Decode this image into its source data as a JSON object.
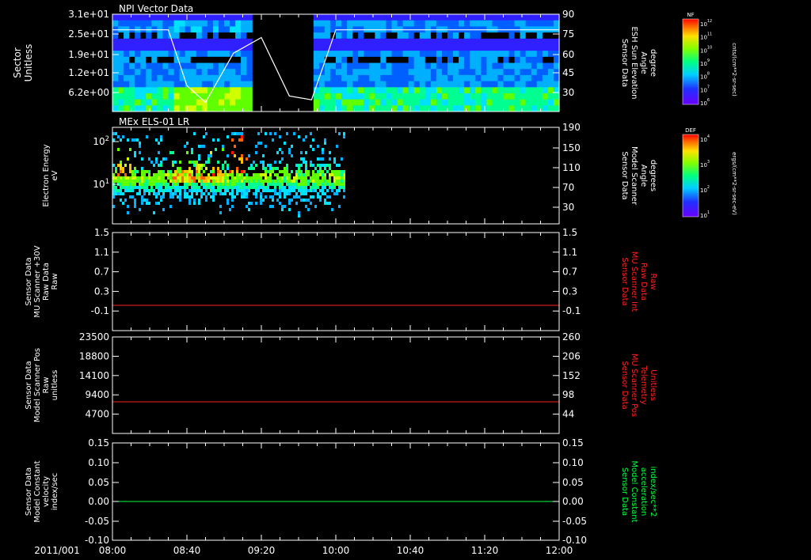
{
  "colors": {
    "background": "#000000",
    "axis": "#ffffff",
    "red_trace": "#ff2020",
    "green_trace": "#00ff40",
    "elevation_curve": "#ffffff"
  },
  "time_axis": {
    "date_label": "2011/001",
    "ticks": [
      "08:00",
      "08:40",
      "09:20",
      "10:00",
      "10:40",
      "11:20",
      "12:00"
    ],
    "range_minutes": [
      0,
      240
    ]
  },
  "panels": [
    {
      "key": "npi",
      "title": "NPI Vector Data",
      "left_label": [
        "Sector",
        "Unitless"
      ],
      "left_ticks": [
        "3.1e+01",
        "2.5e+01",
        "1.9e+01",
        "1.2e+01",
        "6.2e+00"
      ],
      "right_label": [
        "Sensor Data",
        "ESH Sun Elevation",
        "Angle",
        "degree"
      ],
      "right_ticks": [
        "90",
        "75",
        "60",
        "45",
        "30"
      ],
      "colorbar": {
        "label": "NF",
        "units": "cnts/(cm**2-sr-sec)",
        "ticks": [
          "10^12",
          "10^11",
          "10^10",
          "10^9",
          "10^8",
          "10^7",
          "10^6"
        ]
      }
    },
    {
      "key": "els",
      "title": "MEx ELS-01 LR",
      "left_label": [
        "Electron Energy",
        "eV"
      ],
      "left_ticks": [
        "10^2",
        "10^1"
      ],
      "right_label": [
        "Sensor Data",
        "Model Scanner",
        "Angle",
        "degrees"
      ],
      "right_ticks": [
        "190",
        "150",
        "110",
        "70",
        "30"
      ],
      "colorbar": {
        "label": "DEF",
        "units": "ergs/(cm**2-sr-sec-eV)",
        "ticks": [
          "10^4",
          "10^3",
          "10^2",
          "10^1"
        ]
      }
    },
    {
      "key": "mu_int",
      "left_label": [
        "Sensor Data",
        "MU Scanner +30V",
        "Raw Data",
        "Raw"
      ],
      "left_ticks": [
        "1.5",
        "1.1",
        "0.7",
        "0.3",
        "-0.1"
      ],
      "right_label": [
        "Sensor Data",
        "MU Scanner Int",
        "Raw Data",
        "Raw"
      ],
      "right_ticks": [
        "1.5",
        "1.1",
        "0.7",
        "0.3",
        "-0.1"
      ],
      "trace_value": 0.0
    },
    {
      "key": "mu_pos",
      "left_label": [
        "Sensor Data",
        "Model Scanner Pos",
        "Raw",
        "unitless"
      ],
      "left_ticks": [
        "23500",
        "18800",
        "14100",
        "9400",
        "4700"
      ],
      "right_label": [
        "Sensor Data",
        "MU Scanner Pos",
        "Telemetry",
        "Unitless"
      ],
      "right_ticks": [
        "260",
        "206",
        "152",
        "98",
        "44"
      ],
      "trace_value": 8000
    },
    {
      "key": "constant",
      "left_label": [
        "Sensor Data",
        "Model Constant",
        "velocity",
        "index/sec"
      ],
      "left_ticks": [
        "0.15",
        "0.10",
        "0.05",
        "0.00",
        "-0.05",
        "-0.10"
      ],
      "right_label": [
        "Sensor Data",
        "Model Constant",
        "acceleration",
        "index/sec**2"
      ],
      "right_ticks": [
        "0.15",
        "0.10",
        "0.05",
        "0.00",
        "-0.05",
        "-0.10"
      ],
      "trace_value": 0.0
    }
  ],
  "chart_data": [
    {
      "type": "heatmap",
      "title": "NPI Vector Data",
      "ylabel": "Sector Unitless",
      "y2label": "Sensor Data ESH Sun Elevation Angle degree",
      "data_gap_minutes": [
        77,
        107
      ],
      "sun_elevation": {
        "x_minutes": [
          0,
          30,
          40,
          50,
          65,
          80,
          95,
          107,
          120,
          140,
          150,
          240
        ],
        "y_degrees": [
          78,
          78,
          35,
          22,
          60,
          72,
          27,
          24,
          78,
          78,
          78,
          78
        ]
      }
    },
    {
      "type": "heatmap",
      "title": "MEx ELS-01 LR",
      "ylabel": "Electron Energy eV",
      "y2label": "Sensor Data Model Scanner Angle degrees",
      "data_extent_minutes": [
        0,
        125
      ]
    },
    {
      "type": "line",
      "ylabel": "Sensor Data MU Scanner +30V Raw Data Raw",
      "y2label": "Sensor Data MU Scanner Int Raw Data Raw",
      "ylim": [
        -0.3,
        1.5
      ],
      "series": [
        {
          "x_minutes": [
            0,
            240
          ],
          "values": [
            0.0,
            0.0
          ]
        }
      ]
    },
    {
      "type": "line",
      "ylabel": "Sensor Data Model Scanner Pos Raw unitless",
      "y2label": "Sensor Data MU Scanner Pos Telemetry Unitless",
      "ylim": [
        0,
        23500
      ],
      "series": [
        {
          "x_minutes": [
            0,
            240
          ],
          "values": [
            8000,
            8000
          ]
        }
      ]
    },
    {
      "type": "line",
      "ylabel": "Sensor Data Model Constant velocity index/sec",
      "y2label": "Sensor Data Model Constant acceleration index/sec**2",
      "ylim": [
        -0.1,
        0.15
      ],
      "series": [
        {
          "x_minutes": [
            0,
            240
          ],
          "values": [
            0.0,
            0.0
          ]
        }
      ]
    }
  ]
}
